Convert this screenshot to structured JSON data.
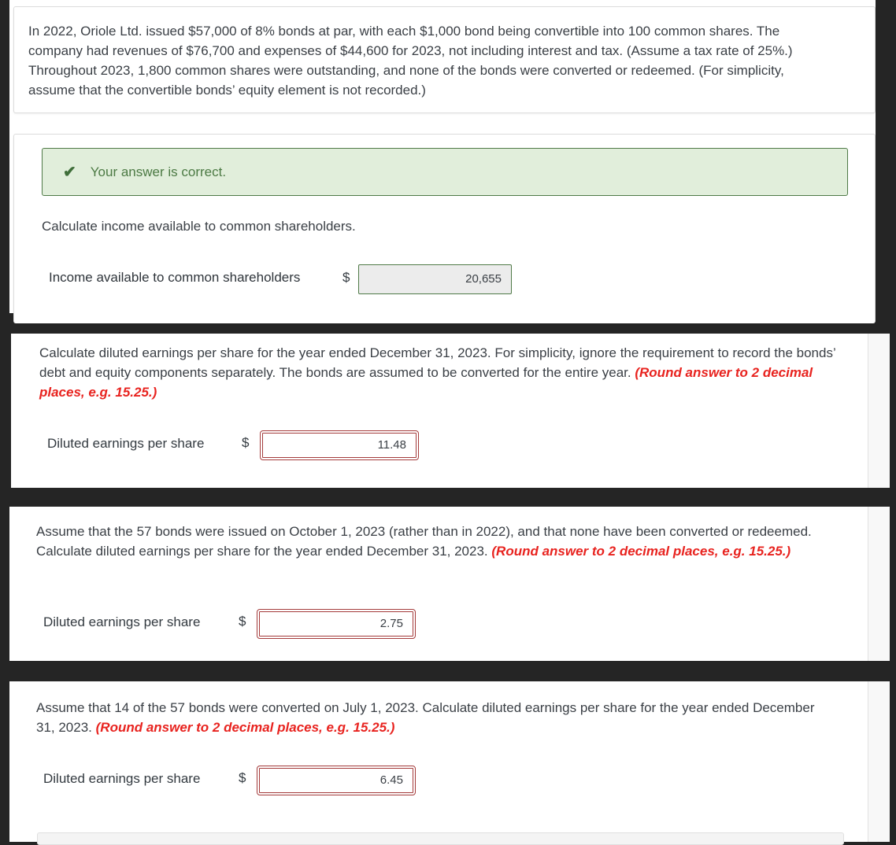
{
  "problem": {
    "text": "In 2022, Oriole Ltd. issued $57,000 of 8% bonds at par, with each $1,000 bond being convertible into 100 common shares. The company had revenues of $76,700 and expenses of $44,600 for 2023, not including interest and tax. (Assume a tax rate of 25%.) Throughout 2023, 1,800 common shares were outstanding, and none of the bonds were converted or redeemed. (For simplicity, assume that the convertible bonds’ equity element is not recorded.)"
  },
  "part1": {
    "feedback": "Your answer is correct.",
    "question": "Calculate income available to common shareholders.",
    "field_label": "Income available to common shareholders",
    "currency": "$",
    "value": "20,655",
    "status": "correct"
  },
  "part2": {
    "question": "Calculate diluted earnings per share for the year ended December 31, 2023. For simplicity, ignore the requirement to record the bonds’ debt and equity components separately. The bonds are assumed to be converted for the entire year.",
    "instruction": "(Round answer to 2 decimal places, e.g. 15.25.)",
    "field_label": "Diluted earnings per share",
    "currency": "$",
    "value": "11.48",
    "status": "incorrect"
  },
  "part3": {
    "question": "Assume that the 57 bonds were issued on October 1, 2023 (rather than in 2022), and that none have been converted or redeemed. Calculate diluted earnings per share for the year ended December 31, 2023.",
    "instruction": "(Round answer to 2 decimal places, e.g. 15.25.)",
    "field_label": "Diluted earnings per share",
    "currency": "$",
    "value": "2.75",
    "status": "incorrect"
  },
  "part4": {
    "question": "Assume that 14 of the 57 bonds were converted on July 1, 2023. Calculate diluted earnings per share for the year ended December 31, 2023.",
    "instruction": "(Round answer to 2 decimal places, e.g. 15.25.)",
    "field_label": "Diluted earnings per share",
    "currency": "$",
    "value": "6.45",
    "status": "incorrect"
  },
  "icons": {
    "check": "checkmark-icon"
  },
  "colors": {
    "success_bg": "#e1eedb",
    "success_border": "#4f7a47",
    "error_border": "#a43b3b",
    "instruction_red": "#e8231f"
  }
}
